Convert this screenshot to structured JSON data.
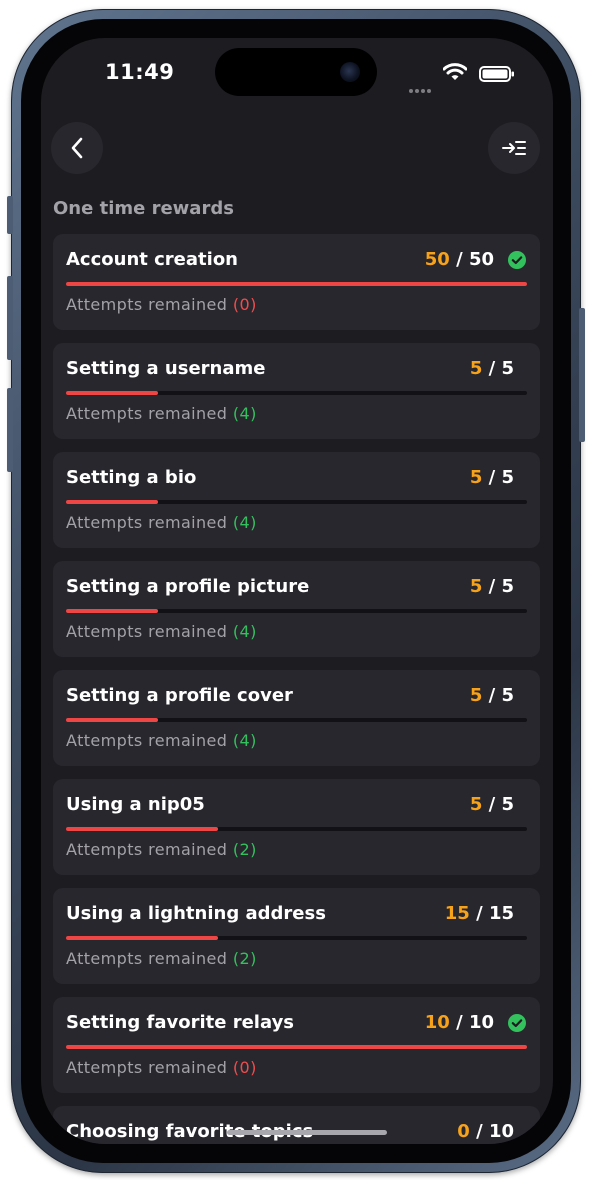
{
  "status_bar": {
    "time": "11:49"
  },
  "header": {
    "back_icon": "chevron-left-icon",
    "action_icon": "collapse-right-icon"
  },
  "section": {
    "title": "One time rewards"
  },
  "attempts_label": "Attempts remained",
  "colors": {
    "accent_orange": "#f7a21b",
    "progress_red": "#ee4545",
    "success_green": "#33c15e",
    "zero_red": "#ef4d4d",
    "card_bg": "#28272d",
    "screen_bg": "#1d1c21"
  },
  "rewards": [
    {
      "title": "Account creation",
      "current": "50",
      "total": "50",
      "attempts": "(0)",
      "progress": 1.0,
      "completed": true
    },
    {
      "title": "Setting a username",
      "current": "5",
      "total": "5",
      "attempts": "(4)",
      "progress": 0.2,
      "completed": false
    },
    {
      "title": "Setting a bio",
      "current": "5",
      "total": "5",
      "attempts": "(4)",
      "progress": 0.2,
      "completed": false
    },
    {
      "title": "Setting a profile picture",
      "current": "5",
      "total": "5",
      "attempts": "(4)",
      "progress": 0.2,
      "completed": false
    },
    {
      "title": "Setting a profile cover",
      "current": "5",
      "total": "5",
      "attempts": "(4)",
      "progress": 0.2,
      "completed": false
    },
    {
      "title": "Using a nip05",
      "current": "5",
      "total": "5",
      "attempts": "(2)",
      "progress": 0.33,
      "completed": false
    },
    {
      "title": "Using a lightning address",
      "current": "15",
      "total": "15",
      "attempts": "(2)",
      "progress": 0.33,
      "completed": false
    },
    {
      "title": "Setting favorite relays",
      "current": "10",
      "total": "10",
      "attempts": "(0)",
      "progress": 1.0,
      "completed": true
    },
    {
      "title": "Choosing favorite topics",
      "current": "0",
      "total": "10",
      "attempts": "",
      "progress": 0,
      "completed": false
    }
  ]
}
